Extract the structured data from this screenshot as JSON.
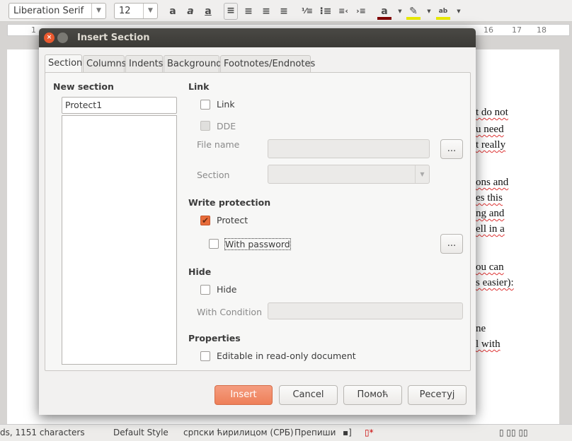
{
  "toolbar": {
    "font_name": "Liberation Serif",
    "font_size": "12",
    "buttons": [
      "bold",
      "italic",
      "underline",
      "align-left",
      "align-center",
      "align-right",
      "justify",
      "numbering",
      "bullets",
      "decrease-indent",
      "increase-indent",
      "font-color",
      "highlight",
      "character-background"
    ],
    "font_color": "#800000",
    "highlight_color": "#e8e800"
  },
  "ruler": {
    "labels": [
      "1",
      "16",
      "17",
      "18"
    ]
  },
  "document": {
    "lines": [
      "t do not",
      "u need",
      "t really",
      "ons and",
      "es this",
      "ng and",
      "ell in a",
      "ou can",
      "s easier):",
      "ne",
      "l with"
    ]
  },
  "dialog": {
    "title": "Insert Section",
    "tabs": [
      "Section",
      "Columns",
      "Indents",
      "Background",
      "Footnotes/Endnotes"
    ],
    "active_tab": "Section",
    "new_section": {
      "heading": "New section",
      "value": "Protect1"
    },
    "link": {
      "heading": "Link",
      "link_label": "Link",
      "link_checked": false,
      "dde_label": "DDE",
      "dde_checked": false,
      "file_name_label": "File name",
      "file_name_value": "",
      "browse_label": "...",
      "section_label": "Section",
      "section_value": ""
    },
    "write_protection": {
      "heading": "Write protection",
      "protect_label": "Protect",
      "protect_checked": true,
      "password_label": "With password",
      "password_checked": false,
      "password_button": "..."
    },
    "hide": {
      "heading": "Hide",
      "hide_label": "Hide",
      "hide_checked": false,
      "condition_label": "With Condition",
      "condition_value": ""
    },
    "properties": {
      "heading": "Properties",
      "editable_label": "Editable in read-only document",
      "editable_checked": false
    },
    "buttons": {
      "insert": "Insert",
      "cancel": "Cancel",
      "help": "Помоћ",
      "reset": "Ресетуј"
    },
    "accent_color": "#ee7f58"
  },
  "status": {
    "words": "ds, 1151 characters",
    "style": "Default Style",
    "language": "српски ћирилицом (СРБ)",
    "mode": "Препиши"
  }
}
